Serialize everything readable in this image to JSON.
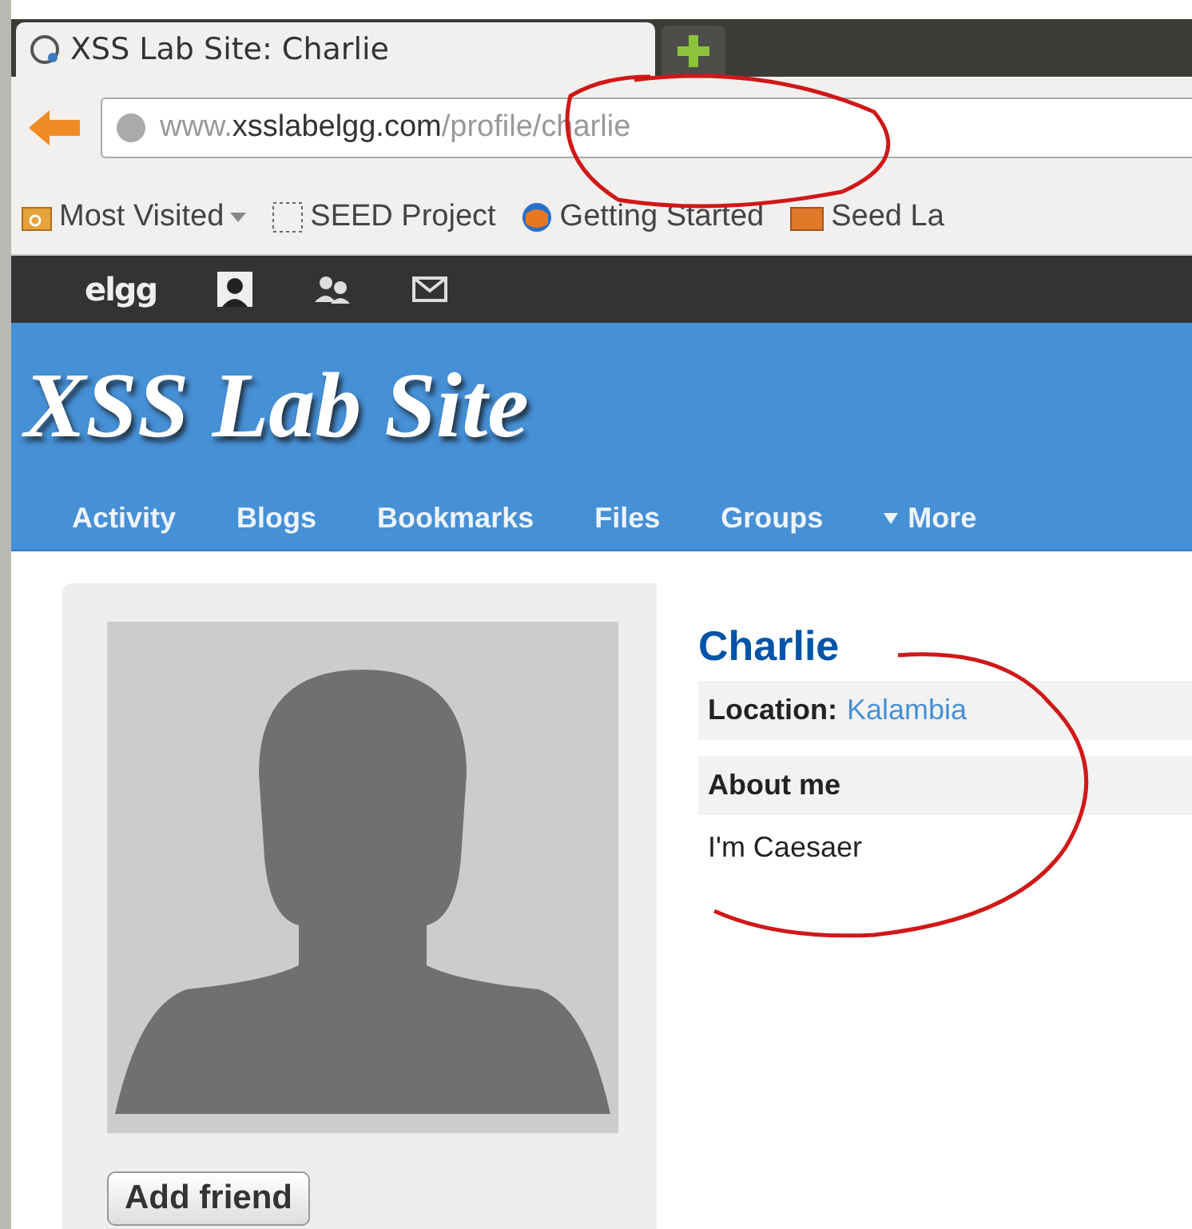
{
  "browser": {
    "tab": {
      "title": "XSS Lab Site: Charlie",
      "selected": true
    },
    "url": {
      "host_prefix": "www.",
      "host": "xsslabelgg.com",
      "path": "/profile/charlie"
    },
    "bookmarks": [
      {
        "label": "Most Visited",
        "kind": "dropdown"
      },
      {
        "label": "SEED Project",
        "kind": "page"
      },
      {
        "label": "Getting Started",
        "kind": "browser"
      },
      {
        "label": "Seed La",
        "kind": "folder"
      }
    ]
  },
  "topbar": {
    "logo": "elgg"
  },
  "site": {
    "title": "XSS Lab Site",
    "menu": [
      {
        "label": "Activity",
        "kind": "link"
      },
      {
        "label": "Blogs",
        "kind": "link"
      },
      {
        "label": "Bookmarks",
        "kind": "link"
      },
      {
        "label": "Files",
        "kind": "link"
      },
      {
        "label": "Groups",
        "kind": "link"
      },
      {
        "label": "More",
        "kind": "dropdown"
      }
    ]
  },
  "profile": {
    "name": "Charlie",
    "location_label": "Location:",
    "location": "Kalambia",
    "about_label": "About me",
    "about": "I'm Caesaer",
    "button": "Add friend"
  }
}
